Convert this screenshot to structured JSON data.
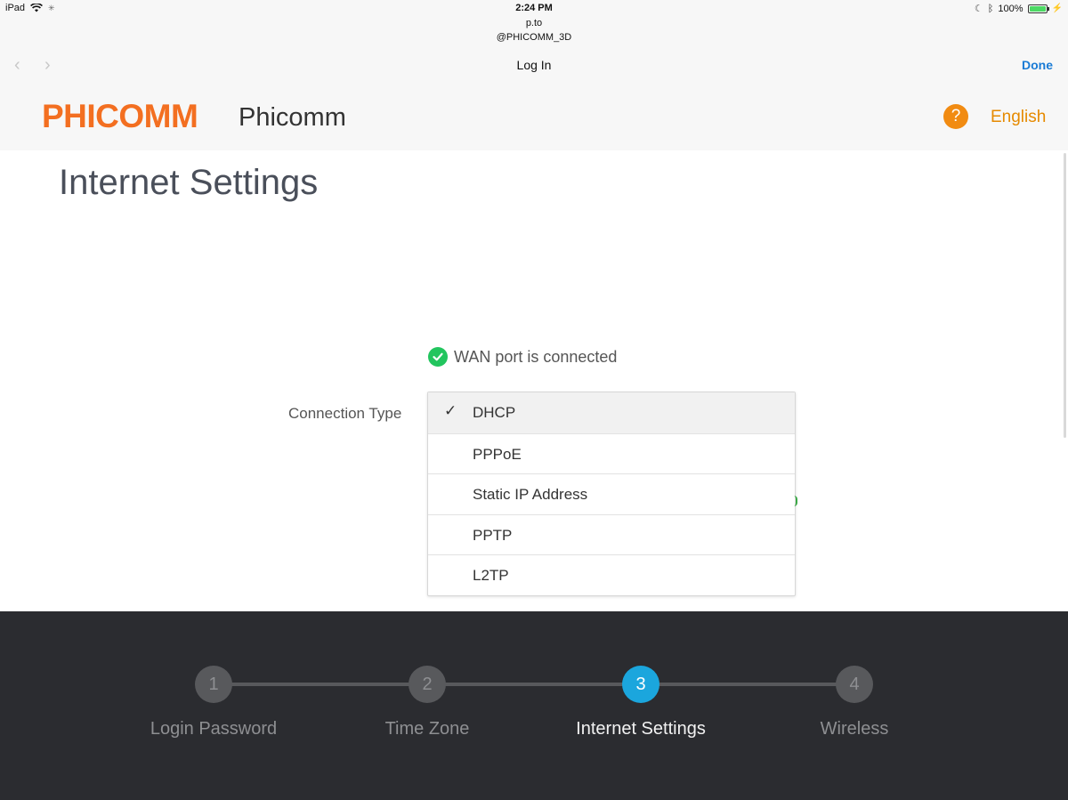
{
  "status_bar": {
    "device": "iPad",
    "time": "2:24 PM",
    "battery": "100%"
  },
  "browser": {
    "host": "p.to",
    "account": "@PHICOMM_3D",
    "title": "Log In",
    "done_label": "Done",
    "back_icon": "chevron-left-icon",
    "forward_icon": "chevron-right-icon"
  },
  "header": {
    "logo_text": "PHICOMM",
    "brand_name": "Phicomm",
    "help_icon": "?",
    "language": "English"
  },
  "colors": {
    "brand_orange": "#f36f21",
    "accent_blue": "#1ba6dd",
    "success_green": "#22c55e",
    "footer_bg": "#2b2c30"
  },
  "main": {
    "title": "Internet Settings",
    "wan_status": "WAN port is connected",
    "connection_type_label": "Connection Type",
    "options": [
      {
        "label": "DHCP",
        "selected": true
      },
      {
        "label": "PPPoE",
        "selected": false
      },
      {
        "label": "Static IP Address",
        "selected": false
      },
      {
        "label": "PPTP",
        "selected": false
      },
      {
        "label": "L2TP",
        "selected": false
      }
    ]
  },
  "steps": [
    {
      "number": "1",
      "label": "Login Password",
      "active": false
    },
    {
      "number": "2",
      "label": "Time Zone",
      "active": false
    },
    {
      "number": "3",
      "label": "Internet Settings",
      "active": true
    },
    {
      "number": "4",
      "label": "Wireless",
      "active": false
    }
  ]
}
